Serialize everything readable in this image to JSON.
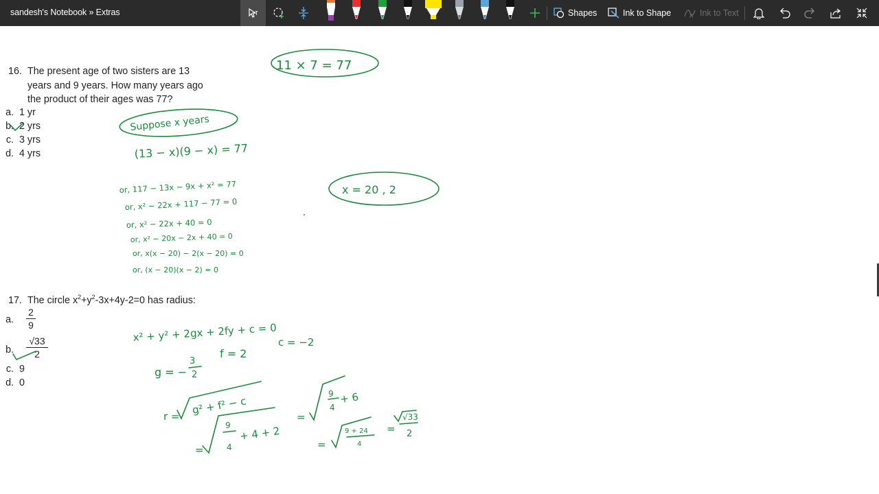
{
  "app": {
    "title": "sandesh's Notebook » Extras"
  },
  "toolbar": {
    "shapes_label": "Shapes",
    "ink_to_shape_label": "Ink to Shape",
    "ink_to_text_label": "Ink to Text",
    "pens": [
      {
        "name": "purple-highlighter",
        "color": "#9b3fb5"
      },
      {
        "name": "red-pen",
        "color": "#e8312f"
      },
      {
        "name": "green-pen",
        "color": "#1f9e3e"
      },
      {
        "name": "black-pen",
        "color": "#111111"
      },
      {
        "name": "yellow-highlighter",
        "color": "#ffe500"
      },
      {
        "name": "gray-pencil",
        "color": "#9aa3ad"
      },
      {
        "name": "galaxy-pen",
        "color": "#5aa6d6"
      },
      {
        "name": "black-marker",
        "color": "#111111"
      }
    ],
    "icons": [
      "lasso-select-icon",
      "ink-select-icon",
      "insert-space-icon",
      "add-pen-icon",
      "shapes-icon",
      "ink-to-shape-icon",
      "ink-to-text-icon",
      "bell-icon",
      "undo-icon",
      "redo-icon",
      "share-icon",
      "fullscreen-exit-icon"
    ]
  },
  "q16": {
    "number": "16.",
    "line1": "The present age of two sisters are 13",
    "line2": "years and 9 years. How many years ago",
    "line3": "the product of their ages was 77?",
    "options": [
      {
        "letter": "a.",
        "text": "1 yr"
      },
      {
        "letter": "b.",
        "text": "2 yrs"
      },
      {
        "letter": "c.",
        "text": "3 yrs"
      },
      {
        "letter": "d.",
        "text": "4 yrs"
      }
    ]
  },
  "q17": {
    "number": "17.",
    "text_pre": "The circle x",
    "sup1": "2",
    "text_mid": "+y",
    "sup2": "2",
    "text_post": "-3x+4y-2=0 has radius:",
    "options": [
      {
        "letter": "a.",
        "num": "2",
        "den": "9"
      },
      {
        "letter": "b.",
        "num": "√33",
        "den": "2"
      },
      {
        "letter": "c.",
        "text": "9"
      },
      {
        "letter": "d.",
        "text": "0"
      }
    ]
  },
  "ink": {
    "ink_color": "#1b8a3c",
    "box1": "11 × 7 = 77",
    "box2": "Suppose x years",
    "eq1": "(13 − x)(9 − x) = 77",
    "eq2": "or, 117 − 13x − 9x + x² = 77",
    "eq3": "or, x² − 22x + 117 − 77 = 0",
    "eq4": "or, x² − 22x + 40 = 0",
    "eq5": "or, x² − 20x − 2x + 40 = 0",
    "eq6": "or, x(x − 20) − 2(x − 20) = 0",
    "eq7": "or, (x − 20)(x − 2) = 0",
    "box3": "x = 20 , 2",
    "c1": "x² + y² + 2gx + 2fy + c = 0",
    "c2_g": "g = −",
    "c2_gnum": "3",
    "c2_gden": "2",
    "c2_f": "f = 2",
    "c2_c": "c = −2",
    "c3_r": "r =",
    "c3_sqrt": "g² + f² − c",
    "c3_eq2": "=",
    "c3_sqrt2_pre": "9",
    "c3_sqrt2_den": "4",
    "c3_sqrt2_post": "+ 6",
    "c4_eq": "=",
    "c4_num": "9",
    "c4_den": "4",
    "c4_rest": "+ 4 + 2",
    "c5_eq": "=",
    "c5_num": "9 + 24",
    "c5_den": "4",
    "c5_eq2": "=",
    "c5_res_num": "√33",
    "c5_res_den": "2"
  }
}
